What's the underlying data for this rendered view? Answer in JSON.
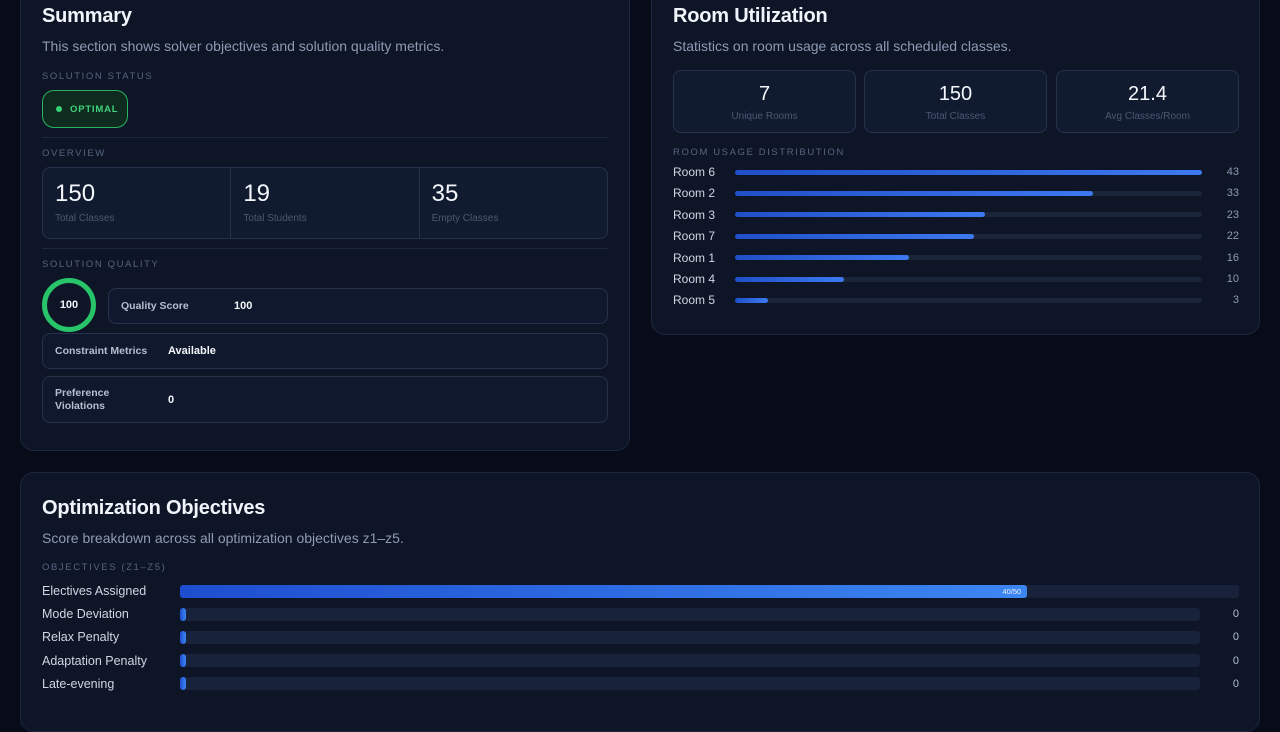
{
  "summary": {
    "title": "Summary",
    "subtitle": "This section shows solver objectives and solution quality metrics.",
    "status_label": "SOLUTION STATUS",
    "status_value": "OPTIMAL",
    "overview_label": "OVERVIEW",
    "overview": [
      {
        "value": "150",
        "label": "Total Classes"
      },
      {
        "value": "19",
        "label": "Total Students"
      },
      {
        "value": "35",
        "label": "Empty Classes"
      }
    ],
    "quality_label": "SOLUTION QUALITY",
    "quality_ring": "100",
    "quality_score_label": "Quality Score",
    "quality_score_value": "100",
    "constraint_label": "Constraint Metrics",
    "constraint_value": "Available",
    "pref_label_line1": "Preference",
    "pref_label_line2": "Violations",
    "pref_value": "0",
    "colors": {
      "ok": "#36d27a"
    }
  },
  "room": {
    "title": "Room Utilization",
    "subtitle": "Statistics on room usage across all scheduled classes.",
    "stats": [
      {
        "value": "7",
        "label": "Unique Rooms"
      },
      {
        "value": "150",
        "label": "Total Classes"
      },
      {
        "value": "21.4",
        "label": "Avg Classes/Room"
      }
    ],
    "dist_label": "ROOM USAGE DISTRIBUTION",
    "rooms": [
      {
        "name": "Room 6",
        "count": 43
      },
      {
        "name": "Room 2",
        "count": 33
      },
      {
        "name": "Room 3",
        "count": 23
      },
      {
        "name": "Room 7",
        "count": 22
      },
      {
        "name": "Room 1",
        "count": 16
      },
      {
        "name": "Room 4",
        "count": 10
      },
      {
        "name": "Room 5",
        "count": 3
      }
    ],
    "max": 43
  },
  "objectives": {
    "title": "Optimization Objectives",
    "subtitle": "Score breakdown across all optimization objectives z1–z5.",
    "label": "OBJECTIVES (Z1–Z5)",
    "items": [
      {
        "name": "Electives Assigned",
        "value": 40,
        "max": 50,
        "inline": "40/50",
        "count": ""
      },
      {
        "name": "Mode Deviation",
        "value": 0,
        "max": 50,
        "inline": "",
        "count": "0"
      },
      {
        "name": "Relax Penalty",
        "value": 0,
        "max": 50,
        "inline": "",
        "count": "0"
      },
      {
        "name": "Adaptation Penalty",
        "value": 0,
        "max": 50,
        "inline": "",
        "count": "0"
      },
      {
        "name": "Late-evening",
        "value": 0,
        "max": 50,
        "inline": "",
        "count": "0"
      }
    ]
  }
}
